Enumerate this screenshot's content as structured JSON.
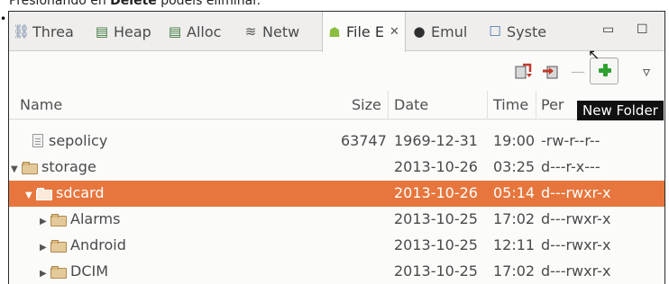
{
  "caption": {
    "text": "Presionando en ",
    "bold": "Delete",
    "rest": " podéis eliminar."
  },
  "tabs": [
    {
      "label": "Threa",
      "icon": "threads-icon",
      "glyph": "⛓"
    },
    {
      "label": "Heap",
      "icon": "heap-icon",
      "glyph": "🗑"
    },
    {
      "label": "Alloc",
      "icon": "allocation-icon",
      "glyph": "🗑"
    },
    {
      "label": "Netw",
      "icon": "network-icon",
      "glyph": "≋"
    },
    {
      "label": "File E",
      "icon": "android-icon",
      "glyph": "☗",
      "active": true,
      "close": "✕"
    },
    {
      "label": "Emul",
      "icon": "emulator-icon",
      "glyph": "●"
    },
    {
      "label": "Syste",
      "icon": "system-info-icon",
      "glyph": "☐"
    }
  ],
  "window_controls": {
    "minimize": "▭",
    "maximize": "☐"
  },
  "toolbar": {
    "pull_icon": "pull-file-icon",
    "push_icon": "push-file-icon",
    "delete_label": "—",
    "new_folder_icon": "plus-icon",
    "menu_label": "▿"
  },
  "tooltip": "New Folder",
  "columns": {
    "name": "Name",
    "size": "Size",
    "date": "Date",
    "time": "Time",
    "permissions": "Per"
  },
  "partial_row": "— — — —",
  "rows": [
    {
      "name": "sepolicy",
      "size": "63747",
      "date": "1969-12-31",
      "time": "19:00",
      "perm": "-rw-r--r--",
      "type": "file",
      "arrow": ""
    },
    {
      "name": "storage",
      "size": "",
      "date": "2013-10-26",
      "time": "03:25",
      "perm": "d---r-x---",
      "type": "folder",
      "arrow": "▼"
    },
    {
      "name": "sdcard",
      "size": "",
      "date": "2013-10-26",
      "time": "05:14",
      "perm": "d---rwxr-x",
      "type": "folder",
      "arrow": "▼",
      "selected": true
    },
    {
      "name": "Alarms",
      "size": "",
      "date": "2013-10-25",
      "time": "17:02",
      "perm": "d---rwxr-x",
      "type": "folder",
      "arrow": "▶"
    },
    {
      "name": "Android",
      "size": "",
      "date": "2013-10-25",
      "time": "12:11",
      "perm": "d---rwxr-x",
      "type": "folder",
      "arrow": "▶"
    },
    {
      "name": "DCIM",
      "size": "",
      "date": "2013-10-25",
      "time": "17:02",
      "perm": "d---rwxr-x",
      "type": "folder",
      "arrow": "▶"
    }
  ],
  "colors": {
    "selection": "#e6763d",
    "plus": "#2fa12f",
    "folder": "#e4c99a"
  }
}
